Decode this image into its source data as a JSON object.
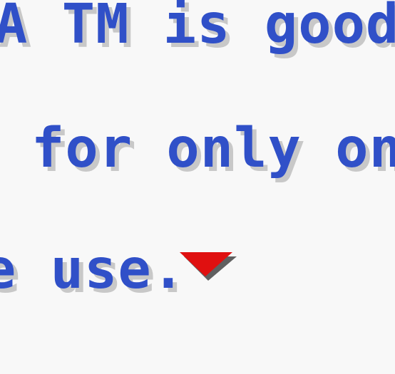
{
  "dialog": {
    "lines": [
      "A TM is good",
      "for only one",
      "e use."
    ],
    "text_color": "#3050c8",
    "shadow_color": "#c8c8c8",
    "background_color": "#f8f8f8",
    "advance_icon": "down-triangle-icon",
    "advance_icon_color": "#e01010"
  }
}
